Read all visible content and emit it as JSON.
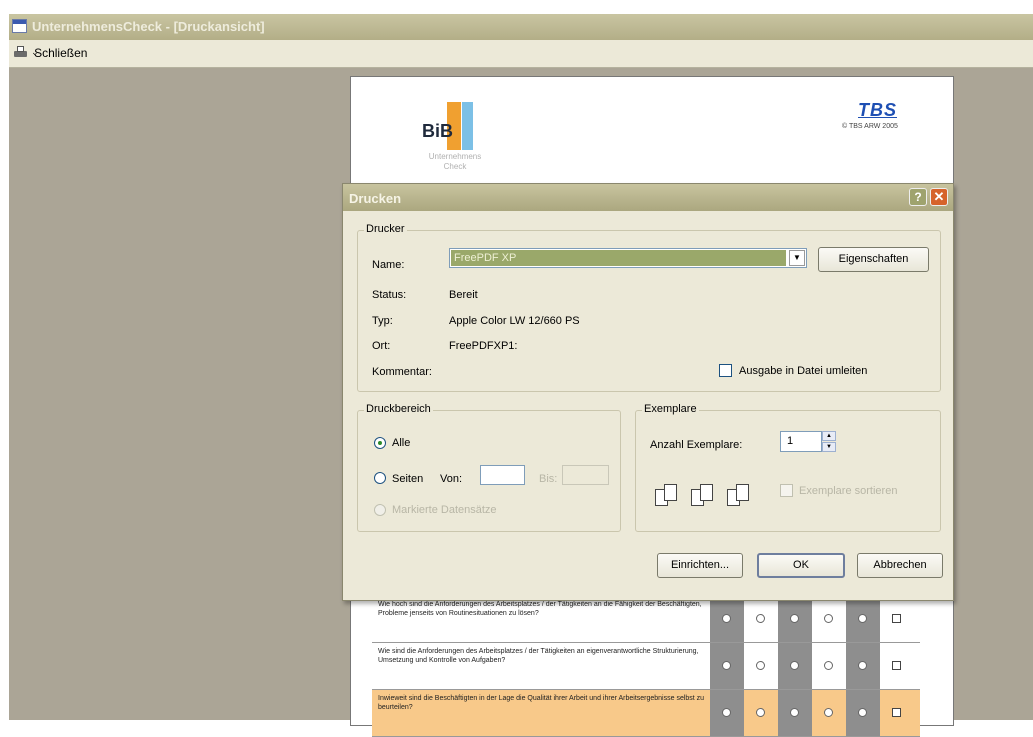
{
  "window": {
    "title": "UnternehmensCheck - [Druckansicht]"
  },
  "toolbar": {
    "close_label": "Schließen",
    "close_icon": "printer-icon"
  },
  "document": {
    "logo_text": "BiB",
    "logo_sub_line1": "Unternehmens",
    "logo_sub_line2": "Check",
    "brand_mark": "TBS",
    "brand_copyright": "© TBS ARW 2005",
    "rows": [
      {
        "text": "Wie hoch sind die Anforderungen des Arbeitsplatzes / der Tätigkeiten an die Fähigkeit der Beschäftigten, Probleme jenseits von Routinesituationen zu lösen?"
      },
      {
        "text": "Wie sind die Anforderungen des Arbeitsplatzes / der Tätigkeiten an eigenverantwortliche Strukturierung, Umsetzung und Kontrolle von Aufgaben?"
      },
      {
        "text": "Inwieweit sind die Beschäftigten in der Lage die Qualität ihrer Arbeit und ihrer Arbeitsergebnisse selbst zu beurteilen?"
      }
    ]
  },
  "dialog": {
    "title": "Drucken",
    "help_label": "?",
    "close_label": "✕",
    "printer_group": "Drucker",
    "name_label": "Name:",
    "printer_name": "FreePDF XP",
    "properties_button": "Eigenschaften",
    "status_label": "Status:",
    "status_value": "Bereit",
    "type_label": "Typ:",
    "type_value": "Apple Color LW 12/660 PS",
    "location_label": "Ort:",
    "location_value": "FreePDFXP1:",
    "comment_label": "Kommentar:",
    "print_to_file_label": "Ausgabe in Datei umleiten",
    "range_group": "Druckbereich",
    "all_label": "Alle",
    "pages_label": "Seiten",
    "from_label": "Von:",
    "to_label": "Bis:",
    "selected_records_label": "Markierte Datensätze",
    "copies_group": "Exemplare",
    "copies_label": "Anzahl Exemplare:",
    "copies_value": "1",
    "collate_label": "Exemplare sortieren",
    "setup_button": "Einrichten...",
    "ok_button": "OK",
    "cancel_button": "Abbrechen"
  }
}
